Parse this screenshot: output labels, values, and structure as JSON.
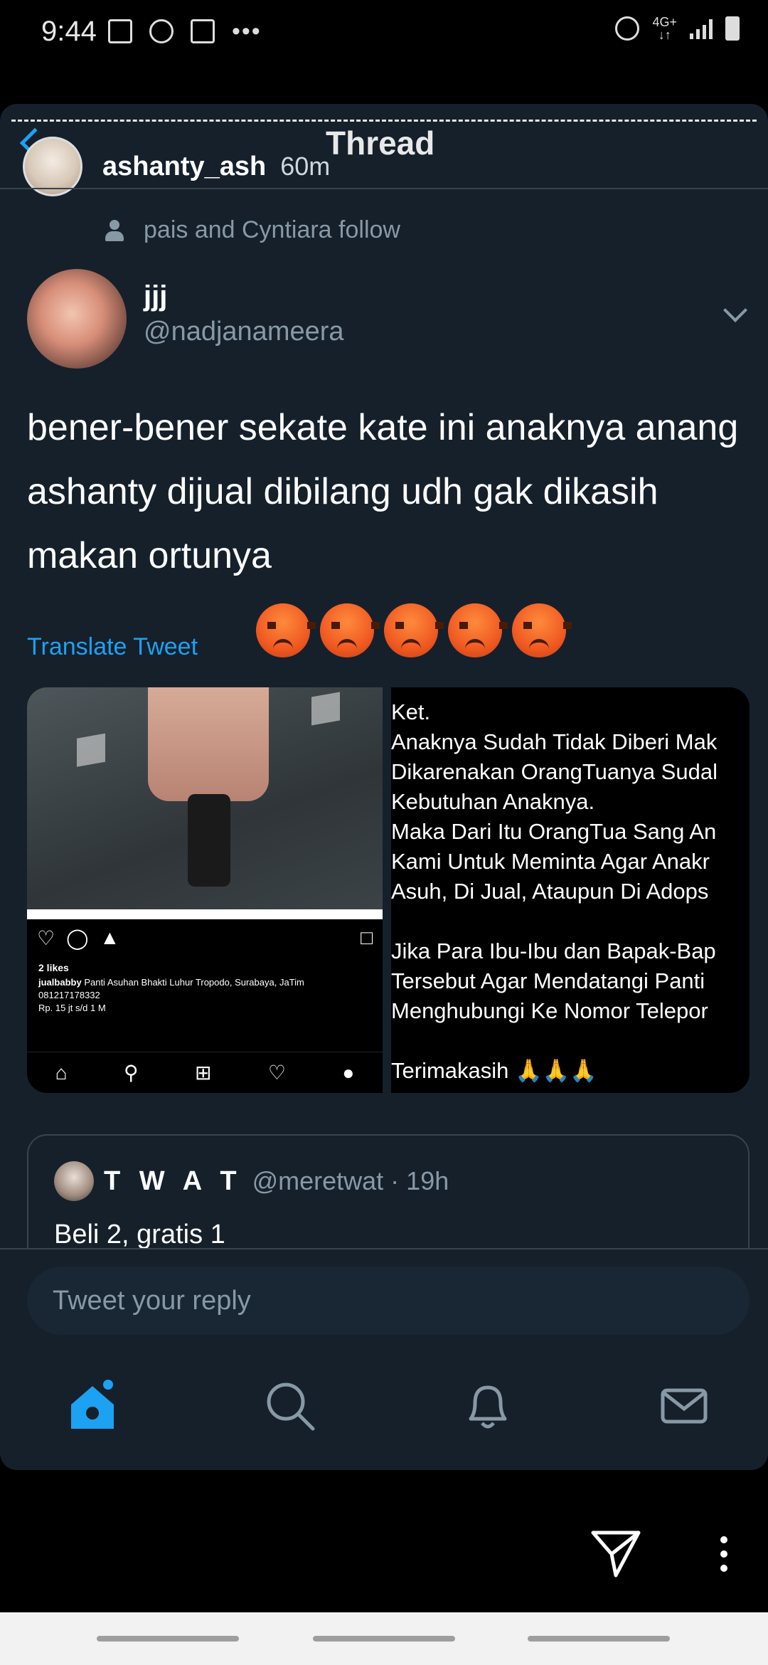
{
  "status_bar": {
    "time": "9:44",
    "more": "•••",
    "network": "4G+",
    "network_arrows": "↓↑"
  },
  "thread": {
    "title": "Thread"
  },
  "story": {
    "username": "ashanty_ash",
    "time_ago": "60m"
  },
  "tweet": {
    "social_context": "pais and Cyntiara follow",
    "author_name": "jjj",
    "author_handle": "@nadjanameera",
    "text": "bener-bener sekate kate ini anaknya anang ashanty dijual dibilang udh gak dikasih makan ortunya",
    "translate_label": "Translate Tweet",
    "emoji_count": 5
  },
  "media": {
    "ig_likes": "2 likes",
    "ig_caption_user": "jualbabby",
    "ig_caption_text": "Panti Asuhan Bhakti Luhur Tropodo, Surabaya, JaTim",
    "ig_caption_phone": "081217178332",
    "ig_caption_price": "Rp. 15 jt s/d 1 M",
    "notice_lines": [
      "Ket.",
      "Anaknya Sudah Tidak Diberi Mak",
      "Dikarenakan OrangTuanya Sudal",
      "Kebutuhan Anaknya.",
      "Maka Dari Itu OrangTua Sang An",
      "Kami Untuk Meminta Agar Anakr",
      "Asuh, Di Jual, Ataupun Di Adops",
      "",
      "Jika Para Ibu-Ibu dan Bapak-Bap",
      "Tersebut Agar Mendatangi Panti",
      "Menghubungi Ke Nomor Telepor",
      "",
      "Terimakasih 🙏🙏🙏"
    ]
  },
  "quote": {
    "name": "T W A T",
    "handle_time": "@meretwat · 19h",
    "text": "Beli 2, gratis 1"
  },
  "reply": {
    "placeholder": "Tweet your reply"
  },
  "colors": {
    "background": "#15202b",
    "accent": "#1da1f2",
    "muted": "#8899a6",
    "divider": "#38444d"
  },
  "icons": [
    "gallery-icon",
    "snapchat-icon",
    "photo-icon",
    "alarm-icon",
    "signal-icon",
    "battery-icon",
    "home-icon",
    "search-icon",
    "bell-icon",
    "mail-icon",
    "send-icon",
    "more-vertical-icon"
  ]
}
